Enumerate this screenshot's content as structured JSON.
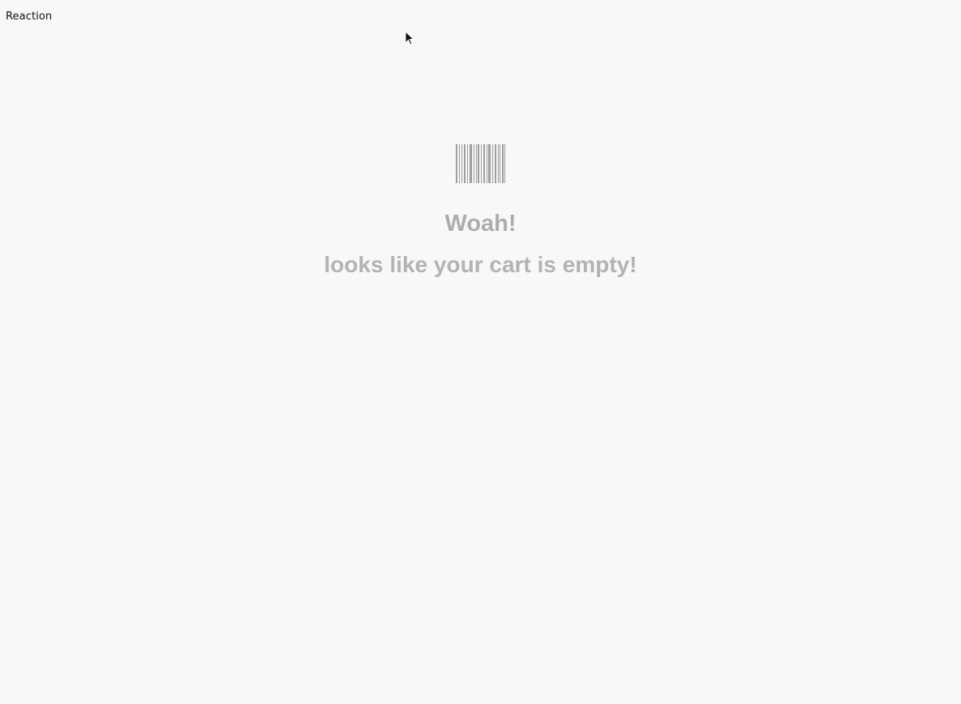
{
  "app": {
    "brand_label": "Reaction"
  },
  "cart": {
    "empty_icon": "barcode-icon",
    "empty_title": "Woah!",
    "empty_message": "looks like your cart is empty!",
    "text_color": "#adadad",
    "background_color": "#f8f8f8"
  }
}
